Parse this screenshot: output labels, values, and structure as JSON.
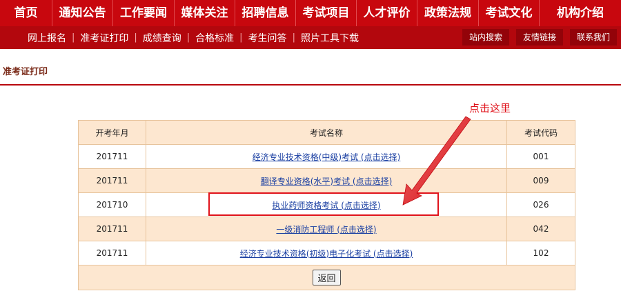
{
  "nav": {
    "main": [
      "首页",
      "通知公告",
      "工作要闻",
      "媒体关注",
      "招聘信息",
      "考试项目",
      "人才评价",
      "政策法规",
      "考试文化",
      "机构介绍"
    ],
    "sub": [
      "网上报名",
      "准考证打印",
      "成绩查询",
      "合格标准",
      "考生问答",
      "照片工具下载"
    ],
    "sep": "|",
    "quick": [
      "站内搜索",
      "友情链接",
      "联系我们"
    ]
  },
  "page": {
    "title": "准考证打印"
  },
  "annotation": {
    "label": "点击这里",
    "color": "#e0121a"
  },
  "table": {
    "headers": [
      "开考年月",
      "考试名称",
      "考试代码"
    ],
    "rows": [
      {
        "date": "201711",
        "name": "经济专业技术资格(中级)考试 (点击选择)",
        "code": "001"
      },
      {
        "date": "201711",
        "name": "翻译专业资格(水平)考试 (点击选择)",
        "code": "009"
      },
      {
        "date": "201710",
        "name": "执业药师资格考试 (点击选择)",
        "code": "026"
      },
      {
        "date": "201711",
        "name": "一级消防工程师 (点击选择)",
        "code": "042"
      },
      {
        "date": "201711",
        "name": "经济专业技术资格(初级)电子化考试 (点击选择)",
        "code": "102"
      }
    ],
    "back_label": "返回"
  },
  "colors": {
    "brand_red": "#c8070e",
    "sub_red": "#b3070d",
    "table_tint": "#fde7d0",
    "link": "#1a3fa2"
  }
}
